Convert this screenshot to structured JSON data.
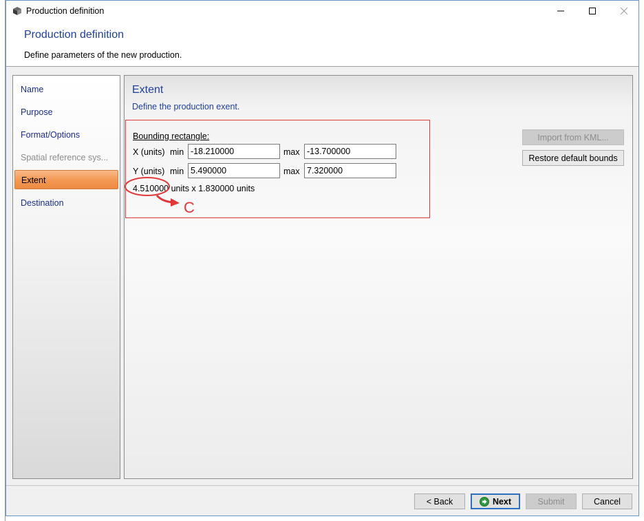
{
  "window": {
    "title": "Production definition",
    "controls": {
      "minimize": "—",
      "maximize": "☐",
      "close": "✕"
    }
  },
  "header": {
    "title": "Production definition",
    "subtitle": "Define parameters of the new production."
  },
  "nav": {
    "items": [
      {
        "label": "Name",
        "state": "normal"
      },
      {
        "label": "Purpose",
        "state": "normal"
      },
      {
        "label": "Format/Options",
        "state": "normal"
      },
      {
        "label": "Spatial reference sys...",
        "state": "disabled"
      },
      {
        "label": "Extent",
        "state": "active"
      },
      {
        "label": "Destination",
        "state": "normal"
      }
    ]
  },
  "extent": {
    "title": "Extent",
    "subtitle": "Define the production exent.",
    "bounding_label": "Bounding rectangle:",
    "x_row": {
      "label": "X (units)",
      "min_label": "min",
      "min_value": "-18.210000",
      "max_label": "max",
      "max_value": "-13.700000"
    },
    "y_row": {
      "label": "Y (units)",
      "min_label": "min",
      "min_value": "5.490000",
      "max_label": "max",
      "max_value": "7.320000"
    },
    "dimensions": "4.510000 units x 1.830000 units",
    "import_kml_label": "Import from KML...",
    "restore_label": "Restore default bounds"
  },
  "annotation": {
    "letter": "C",
    "color": "#e0393a"
  },
  "footer": {
    "back_label": "< Back",
    "next_label": "Next",
    "submit_label": "Submit",
    "cancel_label": "Cancel"
  },
  "colors": {
    "accent_blue": "#1f3ea0",
    "active_orange": "#f39a55",
    "highlight_red": "#e0393a"
  }
}
